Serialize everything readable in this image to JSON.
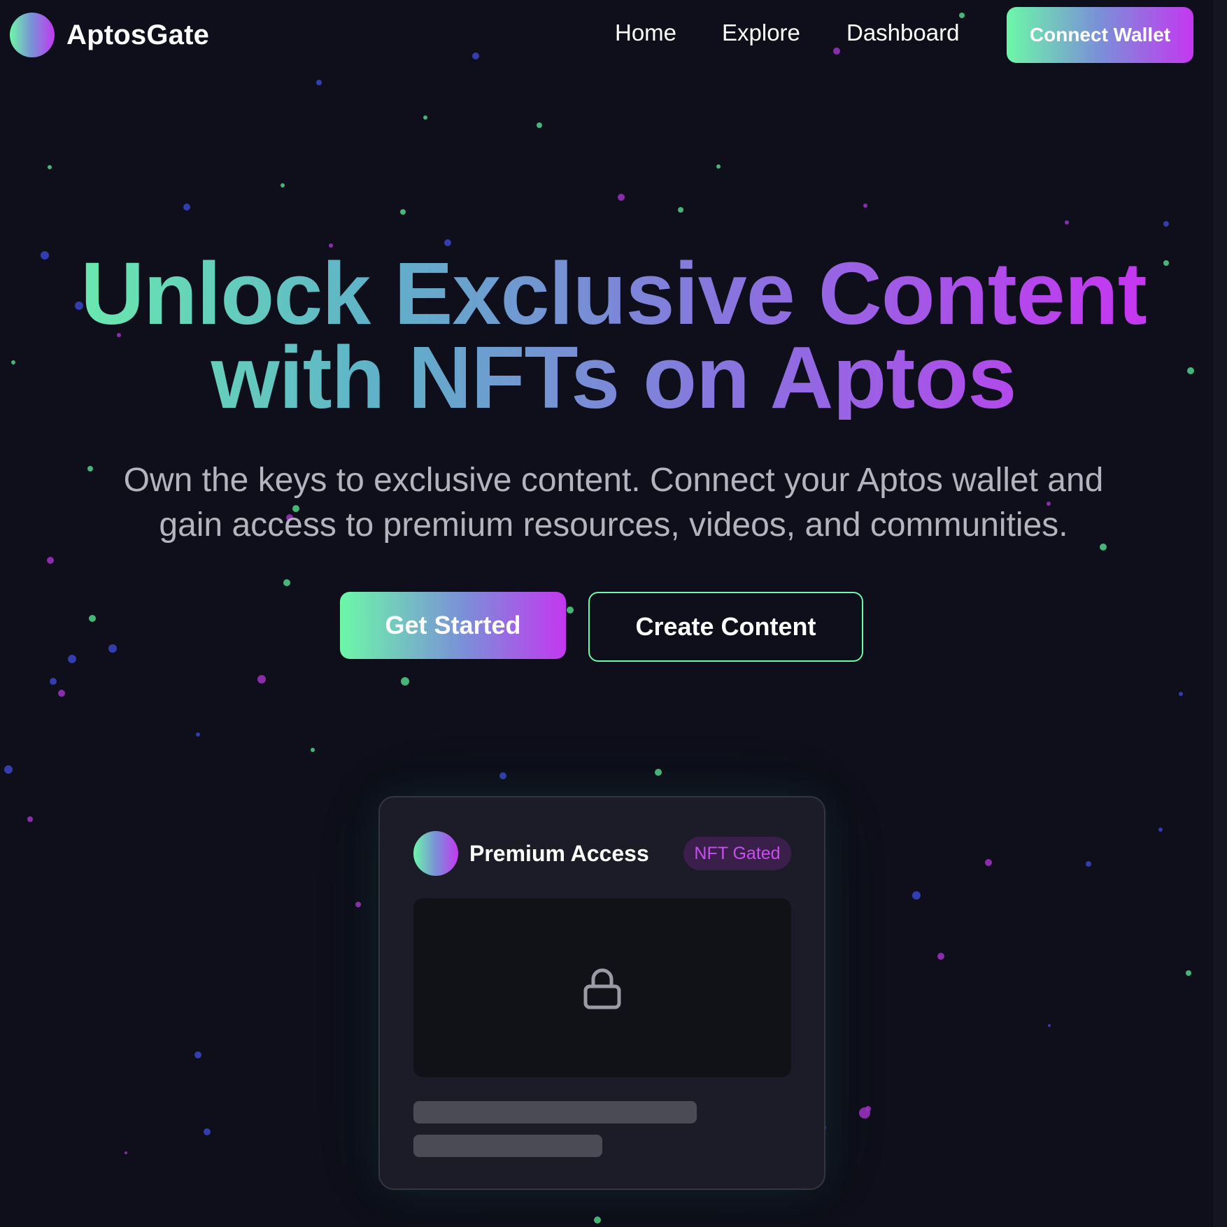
{
  "brand": {
    "name": "AptosGate"
  },
  "nav": {
    "links": [
      "Home",
      "Explore",
      "Dashboard"
    ],
    "connect_label": "Connect Wallet"
  },
  "hero": {
    "title_line1": "Unlock Exclusive Content",
    "title_line2": "with NFTs on Aptos",
    "subtitle_line1": "Own the keys to exclusive content. Connect your Aptos wallet and",
    "subtitle_line2": "gain access to premium resources, videos, and communities.",
    "primary_cta": "Get Started",
    "secondary_cta": "Create Content"
  },
  "card": {
    "title": "Premium Access",
    "badge": "NFT Gated",
    "media_icon": "lock-icon"
  },
  "theme": {
    "background": "#0e0f1a",
    "gradient_start": "#6df7a8",
    "gradient_mid": "#7a8fd8",
    "gradient_end": "#c438f0",
    "muted_text": "#b3b4bd",
    "card_bg": "#1b1c27",
    "badge_bg": "#3a1f4a",
    "badge_text": "#c84ef2"
  }
}
